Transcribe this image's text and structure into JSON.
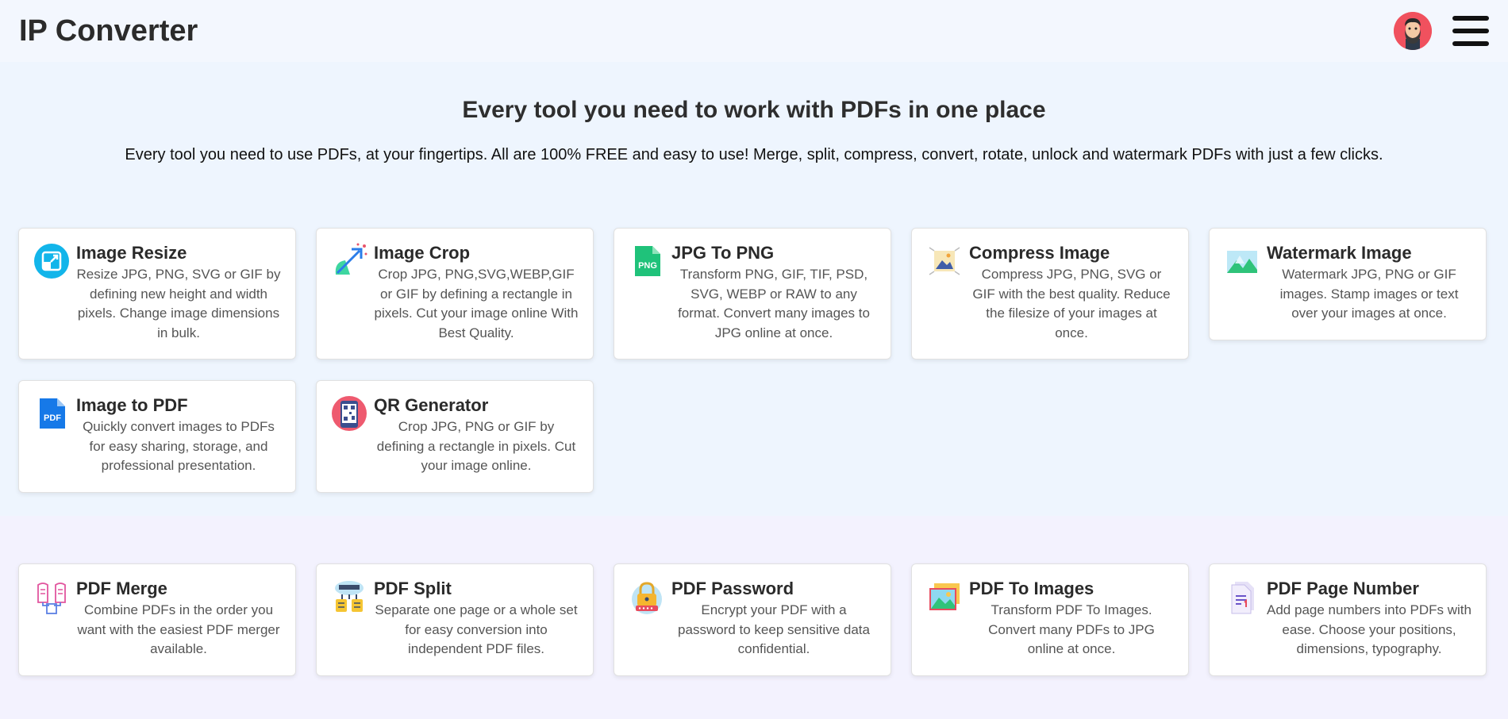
{
  "header": {
    "title": "IP Converter",
    "avatar_icon": "bearded-man-avatar",
    "menu_icon": "hamburger-icon"
  },
  "hero": {
    "heading": "Every tool you need to work with PDFs in one place",
    "subheading": "Every tool you need to use PDFs, at your fingertips. All are 100% FREE and easy to use! Merge, split, compress, convert, rotate, unlock and watermark PDFs with just a few clicks."
  },
  "image_tools": [
    {
      "title": "Image Resize",
      "desc": "Resize JPG, PNG, SVG or GIF by defining new height and width pixels. Change image dimensions in bulk.",
      "icon": "resize-icon"
    },
    {
      "title": "Image Crop",
      "desc": "Crop JPG, PNG,SVG,WEBP,GIF or GIF by defining a rectangle in pixels. Cut your image online With Best Quality.",
      "icon": "crop-icon"
    },
    {
      "title": "JPG To PNG",
      "desc": "Transform PNG, GIF, TIF, PSD, SVG, WEBP or RAW to any format. Convert many images to JPG online at once.",
      "icon": "png-file-icon",
      "icon_text": "PNG"
    },
    {
      "title": "Compress Image",
      "desc": "Compress JPG, PNG, SVG or GIF with the best quality. Reduce the filesize of your images at once.",
      "icon": "compress-image-icon"
    },
    {
      "title": "Watermark Image",
      "desc": "Watermark JPG, PNG or GIF images. Stamp images or text over your images at once.",
      "icon": "watermark-icon"
    },
    {
      "title": "Image to PDF",
      "desc": "Quickly convert images to PDFs for easy sharing, storage, and professional presentation.",
      "icon": "pdf-file-icon",
      "icon_text": "PDF"
    },
    {
      "title": "QR Generator",
      "desc": "Crop JPG, PNG or GIF by defining a rectangle in pixels. Cut your image online.",
      "icon": "qr-phone-icon"
    }
  ],
  "pdf_tools": [
    {
      "title": "PDF Merge",
      "desc": "Combine PDFs in the order you want with the easiest PDF merger available.",
      "icon": "merge-icon"
    },
    {
      "title": "PDF Split",
      "desc": "Separate one page or a whole set for easy conversion into independent PDF files.",
      "icon": "split-icon"
    },
    {
      "title": "PDF Password",
      "desc": "Encrypt your PDF with a password to keep sensitive data confidential.",
      "icon": "lock-icon"
    },
    {
      "title": "PDF To Images",
      "desc": "Transform PDF To Images. Convert many PDFs to JPG online at once.",
      "icon": "images-icon"
    },
    {
      "title": "PDF Page Number",
      "desc": "Add page numbers into PDFs with ease. Choose your positions, dimensions, typography.",
      "icon": "page-number-icon"
    }
  ],
  "colors": {
    "hero_bg": "#eef5fe",
    "section_bg": "#f3f2fe",
    "card_bg": "#ffffff"
  }
}
